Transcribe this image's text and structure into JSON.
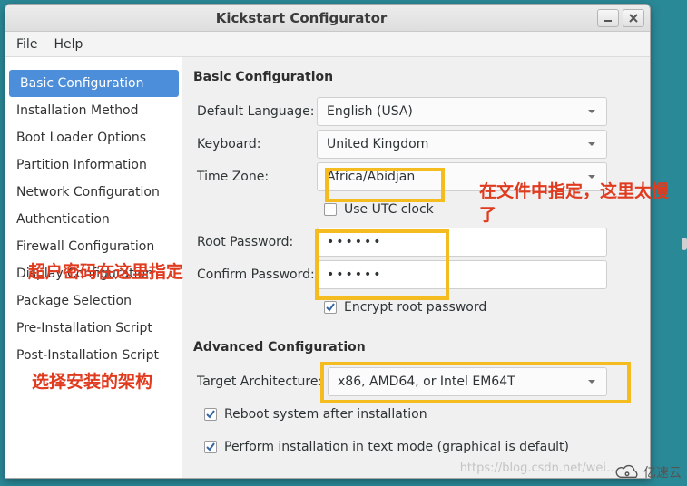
{
  "window": {
    "title": "Kickstart Configurator"
  },
  "menubar": {
    "file": "File",
    "help": "Help"
  },
  "sidebar": {
    "items": [
      {
        "label": "Basic Configuration",
        "selected": true
      },
      {
        "label": "Installation Method"
      },
      {
        "label": "Boot Loader Options"
      },
      {
        "label": "Partition Information"
      },
      {
        "label": "Network Configuration"
      },
      {
        "label": "Authentication"
      },
      {
        "label": "Firewall Configuration"
      },
      {
        "label": "Display Configuration"
      },
      {
        "label": "Package Selection"
      },
      {
        "label": "Pre-Installation Script"
      },
      {
        "label": "Post-Installation Script"
      }
    ]
  },
  "basic": {
    "heading": "Basic Configuration",
    "labels": {
      "default_language": "Default Language:",
      "keyboard": "Keyboard:",
      "time_zone": "Time Zone:",
      "utc": "Use UTC clock",
      "root_pw": "Root Password:",
      "confirm_pw": "Confirm Password:",
      "encrypt": "Encrypt root password"
    },
    "values": {
      "default_language": "English (USA)",
      "keyboard": "United Kingdom",
      "time_zone": "Africa/Abidjan",
      "root_pw_mask": "••••••",
      "confirm_pw_mask": "••••••",
      "utc_checked": false,
      "encrypt_checked": true
    }
  },
  "advanced": {
    "heading": "Advanced Configuration",
    "labels": {
      "target_arch": "Target Architecture:",
      "reboot": "Reboot system after installation",
      "textmode": "Perform installation in text mode (graphical is default)"
    },
    "values": {
      "target_arch": "x86, AMD64, or Intel EM64T",
      "reboot_checked": true,
      "textmode_checked": true
    }
  },
  "annotations": {
    "tz_note": "在文件中指定，这里太慢了",
    "pw_note": "超户密码在这里指定",
    "arch_note": "选择安装的架构"
  },
  "watermark": "https://blog.csdn.net/wei…",
  "logo_text": "亿速云"
}
